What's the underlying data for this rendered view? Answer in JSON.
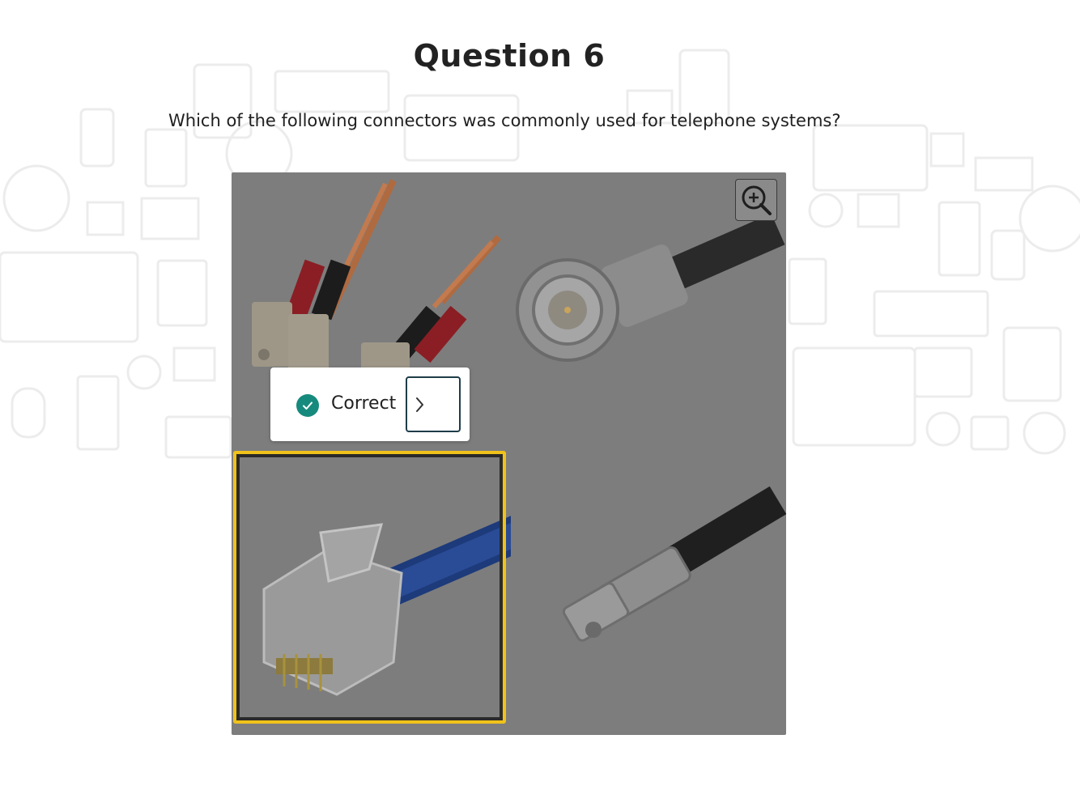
{
  "header": {
    "title": "Question 6"
  },
  "question": {
    "text": "Which of the following connectors was commonly used for telephone systems?"
  },
  "options": [
    {
      "name": "fiber-sc-connector",
      "selected": false
    },
    {
      "name": "bnc-connector",
      "selected": false
    },
    {
      "name": "rj11-connector",
      "selected": true
    },
    {
      "name": "f-type-connector",
      "selected": false
    }
  ],
  "feedback": {
    "status": "Correct",
    "icon": "check-circle-icon",
    "next_icon": "chevron-right-icon"
  },
  "toolbar": {
    "zoom_icon": "zoom-in-icon"
  },
  "colors": {
    "selection_border": "#f0c21a",
    "correct_badge": "#178a7e",
    "overlay": "#7d7d7d"
  }
}
